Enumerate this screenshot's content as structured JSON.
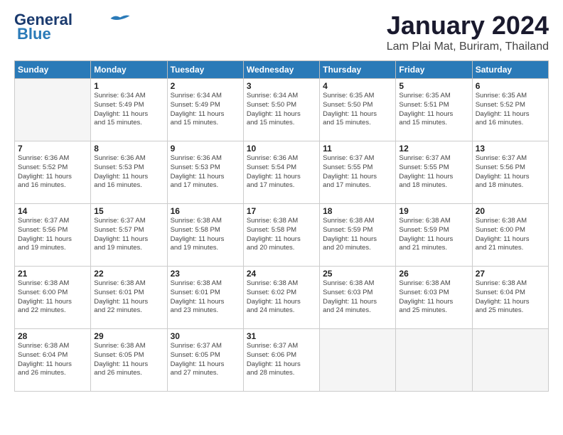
{
  "header": {
    "logo_line1": "General",
    "logo_line2": "Blue",
    "month": "January 2024",
    "location": "Lam Plai Mat, Buriram, Thailand"
  },
  "weekdays": [
    "Sunday",
    "Monday",
    "Tuesday",
    "Wednesday",
    "Thursday",
    "Friday",
    "Saturday"
  ],
  "weeks": [
    [
      {
        "day": "",
        "info": ""
      },
      {
        "day": "1",
        "info": "Sunrise: 6:34 AM\nSunset: 5:49 PM\nDaylight: 11 hours\nand 15 minutes."
      },
      {
        "day": "2",
        "info": "Sunrise: 6:34 AM\nSunset: 5:49 PM\nDaylight: 11 hours\nand 15 minutes."
      },
      {
        "day": "3",
        "info": "Sunrise: 6:34 AM\nSunset: 5:50 PM\nDaylight: 11 hours\nand 15 minutes."
      },
      {
        "day": "4",
        "info": "Sunrise: 6:35 AM\nSunset: 5:50 PM\nDaylight: 11 hours\nand 15 minutes."
      },
      {
        "day": "5",
        "info": "Sunrise: 6:35 AM\nSunset: 5:51 PM\nDaylight: 11 hours\nand 15 minutes."
      },
      {
        "day": "6",
        "info": "Sunrise: 6:35 AM\nSunset: 5:52 PM\nDaylight: 11 hours\nand 16 minutes."
      }
    ],
    [
      {
        "day": "7",
        "info": "Sunrise: 6:36 AM\nSunset: 5:52 PM\nDaylight: 11 hours\nand 16 minutes."
      },
      {
        "day": "8",
        "info": "Sunrise: 6:36 AM\nSunset: 5:53 PM\nDaylight: 11 hours\nand 16 minutes."
      },
      {
        "day": "9",
        "info": "Sunrise: 6:36 AM\nSunset: 5:53 PM\nDaylight: 11 hours\nand 17 minutes."
      },
      {
        "day": "10",
        "info": "Sunrise: 6:36 AM\nSunset: 5:54 PM\nDaylight: 11 hours\nand 17 minutes."
      },
      {
        "day": "11",
        "info": "Sunrise: 6:37 AM\nSunset: 5:55 PM\nDaylight: 11 hours\nand 17 minutes."
      },
      {
        "day": "12",
        "info": "Sunrise: 6:37 AM\nSunset: 5:55 PM\nDaylight: 11 hours\nand 18 minutes."
      },
      {
        "day": "13",
        "info": "Sunrise: 6:37 AM\nSunset: 5:56 PM\nDaylight: 11 hours\nand 18 minutes."
      }
    ],
    [
      {
        "day": "14",
        "info": "Sunrise: 6:37 AM\nSunset: 5:56 PM\nDaylight: 11 hours\nand 19 minutes."
      },
      {
        "day": "15",
        "info": "Sunrise: 6:37 AM\nSunset: 5:57 PM\nDaylight: 11 hours\nand 19 minutes."
      },
      {
        "day": "16",
        "info": "Sunrise: 6:38 AM\nSunset: 5:58 PM\nDaylight: 11 hours\nand 19 minutes."
      },
      {
        "day": "17",
        "info": "Sunrise: 6:38 AM\nSunset: 5:58 PM\nDaylight: 11 hours\nand 20 minutes."
      },
      {
        "day": "18",
        "info": "Sunrise: 6:38 AM\nSunset: 5:59 PM\nDaylight: 11 hours\nand 20 minutes."
      },
      {
        "day": "19",
        "info": "Sunrise: 6:38 AM\nSunset: 5:59 PM\nDaylight: 11 hours\nand 21 minutes."
      },
      {
        "day": "20",
        "info": "Sunrise: 6:38 AM\nSunset: 6:00 PM\nDaylight: 11 hours\nand 21 minutes."
      }
    ],
    [
      {
        "day": "21",
        "info": "Sunrise: 6:38 AM\nSunset: 6:00 PM\nDaylight: 11 hours\nand 22 minutes."
      },
      {
        "day": "22",
        "info": "Sunrise: 6:38 AM\nSunset: 6:01 PM\nDaylight: 11 hours\nand 22 minutes."
      },
      {
        "day": "23",
        "info": "Sunrise: 6:38 AM\nSunset: 6:01 PM\nDaylight: 11 hours\nand 23 minutes."
      },
      {
        "day": "24",
        "info": "Sunrise: 6:38 AM\nSunset: 6:02 PM\nDaylight: 11 hours\nand 24 minutes."
      },
      {
        "day": "25",
        "info": "Sunrise: 6:38 AM\nSunset: 6:03 PM\nDaylight: 11 hours\nand 24 minutes."
      },
      {
        "day": "26",
        "info": "Sunrise: 6:38 AM\nSunset: 6:03 PM\nDaylight: 11 hours\nand 25 minutes."
      },
      {
        "day": "27",
        "info": "Sunrise: 6:38 AM\nSunset: 6:04 PM\nDaylight: 11 hours\nand 25 minutes."
      }
    ],
    [
      {
        "day": "28",
        "info": "Sunrise: 6:38 AM\nSunset: 6:04 PM\nDaylight: 11 hours\nand 26 minutes."
      },
      {
        "day": "29",
        "info": "Sunrise: 6:38 AM\nSunset: 6:05 PM\nDaylight: 11 hours\nand 26 minutes."
      },
      {
        "day": "30",
        "info": "Sunrise: 6:37 AM\nSunset: 6:05 PM\nDaylight: 11 hours\nand 27 minutes."
      },
      {
        "day": "31",
        "info": "Sunrise: 6:37 AM\nSunset: 6:06 PM\nDaylight: 11 hours\nand 28 minutes."
      },
      {
        "day": "",
        "info": ""
      },
      {
        "day": "",
        "info": ""
      },
      {
        "day": "",
        "info": ""
      }
    ]
  ]
}
